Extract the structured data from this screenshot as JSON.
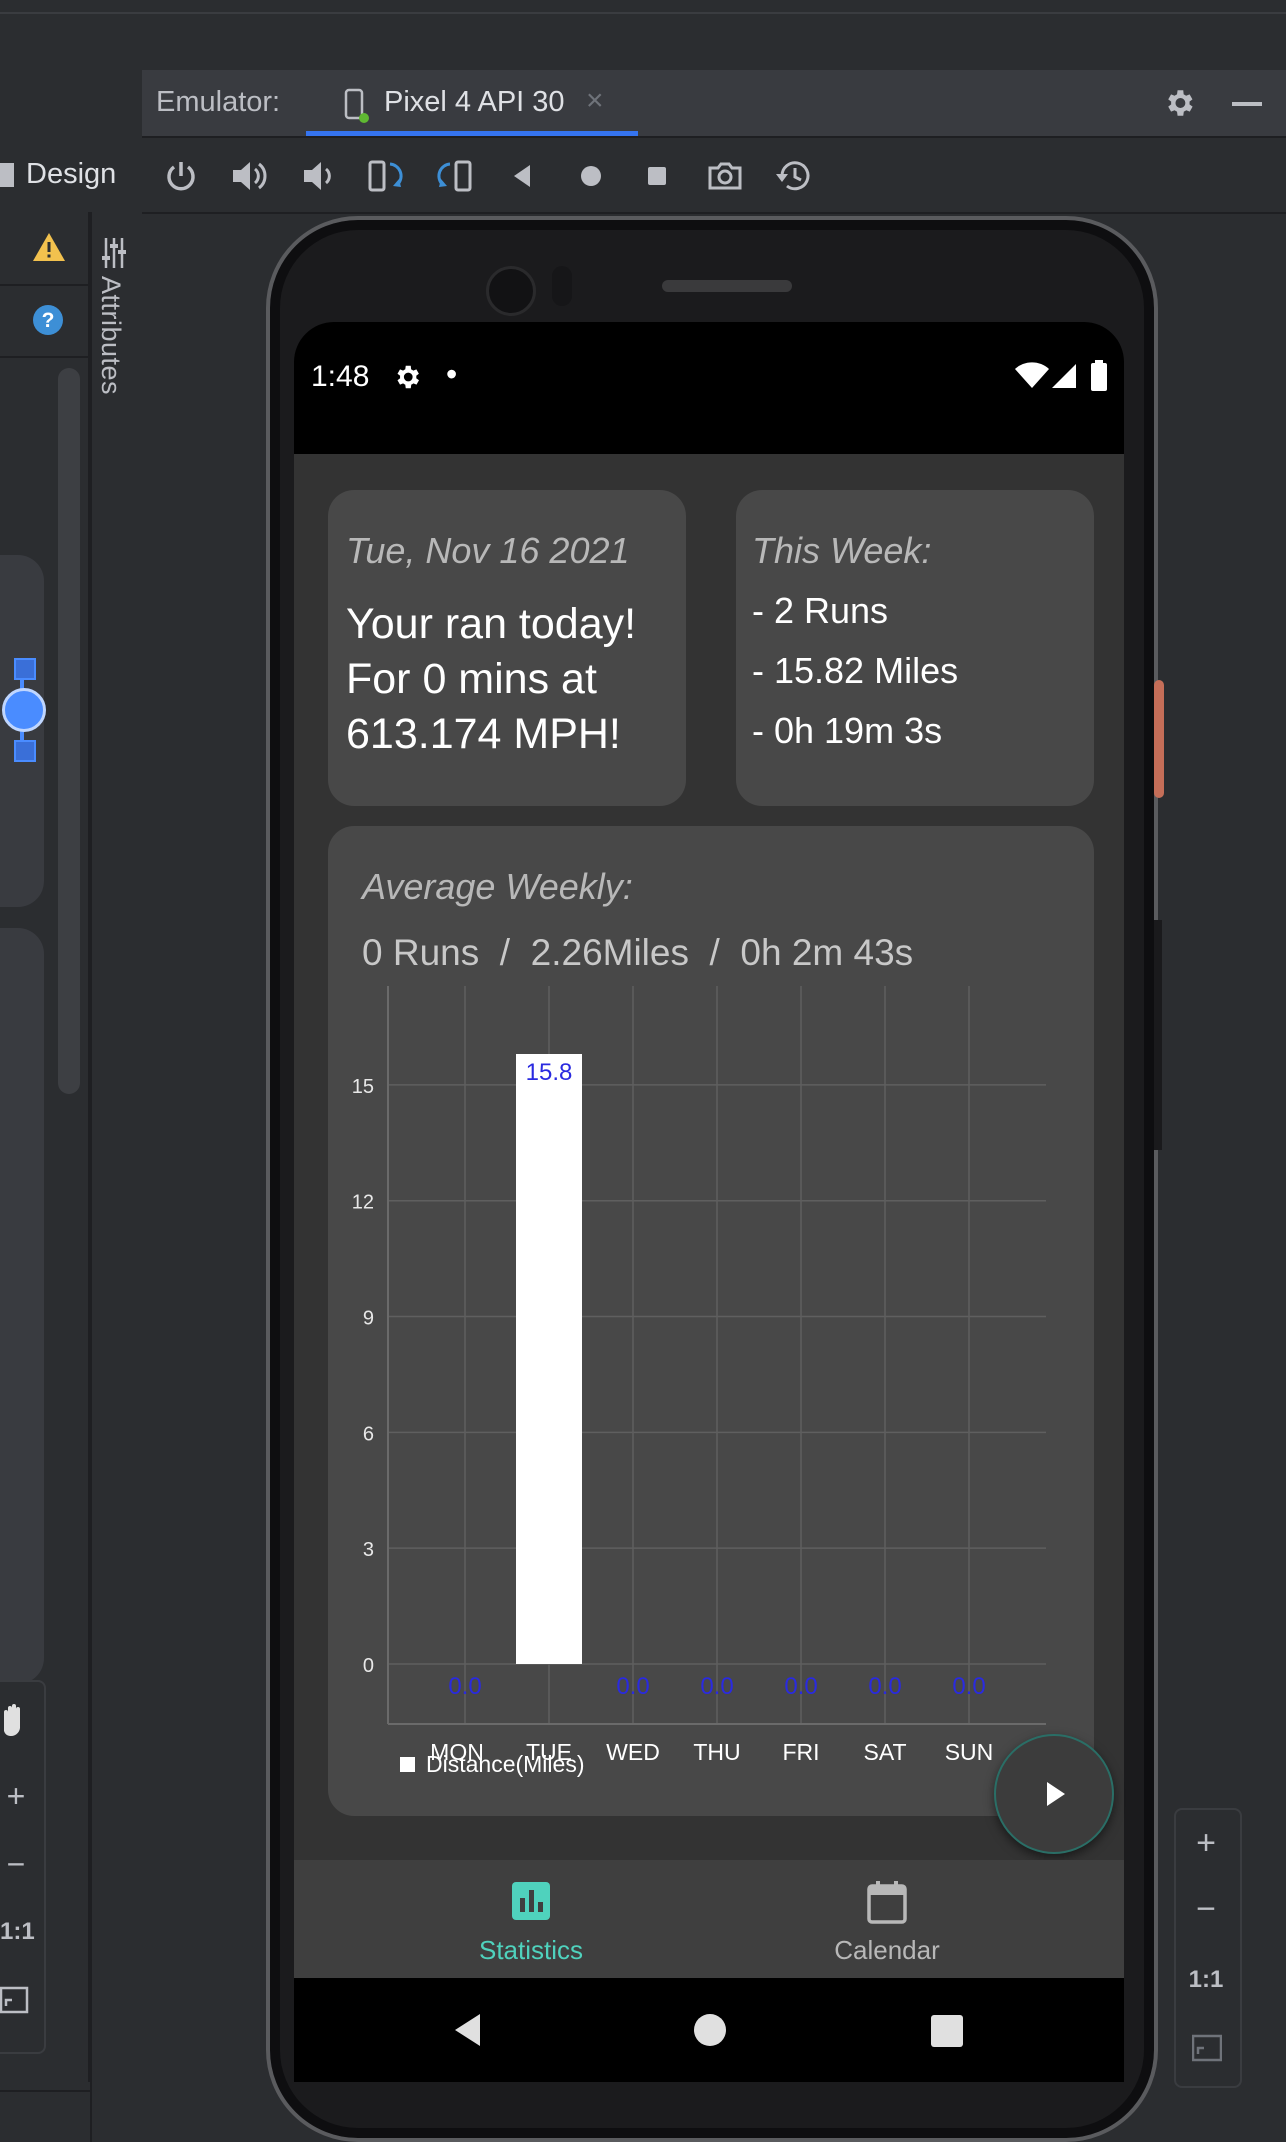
{
  "ide": {
    "emulator_label": "Emulator:",
    "device_name": "Pixel 4 API 30",
    "tab_close": "×",
    "design_label": "Design",
    "attributes_label": "Attributes",
    "left_zoom": {
      "plus": "+",
      "minus": "−",
      "one_to_one": "1:1"
    },
    "right_zoom": {
      "plus": "+",
      "minus": "−",
      "one_to_one": "1:1"
    },
    "toolbar_icons": [
      "power-icon",
      "volume-up-icon",
      "volume-down-icon",
      "rotate-left-icon",
      "rotate-right-icon",
      "back-icon",
      "home-icon",
      "overview-icon",
      "camera-icon",
      "snapshot-icon"
    ],
    "accent_color": "#3574f0"
  },
  "phone": {
    "status": {
      "time": "1:48",
      "dot": "•"
    },
    "today_card": {
      "date": "Tue, Nov 16 2021",
      "line1": "Your ran today!",
      "line2": "For 0 mins at",
      "line3": "613.174 MPH!"
    },
    "week_card": {
      "title": "This Week:",
      "runs": "- 2 Runs",
      "miles": "- 15.82 Miles",
      "time": "- 0h 19m 3s"
    },
    "average_card": {
      "title": "Average Weekly:",
      "summary": "0 Runs  /  2.26Miles  /  0h 2m 43s"
    },
    "bottom_nav": [
      {
        "label": "Statistics",
        "icon": "bar-chart-icon",
        "active": true
      },
      {
        "label": "Calendar",
        "icon": "calendar-icon",
        "active": false
      }
    ],
    "accent_color": "#4fd2bd"
  },
  "chart_data": {
    "type": "bar",
    "categories": [
      "MON",
      "TUE",
      "WED",
      "THU",
      "FRI",
      "SAT",
      "SUN"
    ],
    "series": [
      {
        "name": "Distance(Miles)",
        "values": [
          0.0,
          15.8,
          0.0,
          0.0,
          0.0,
          0.0,
          0.0
        ],
        "color": "#ffffff"
      }
    ],
    "value_labels": [
      "0.0",
      "15.8",
      "0.0",
      "0.0",
      "0.0",
      "0.0",
      "0.0"
    ],
    "yticks": [
      "0",
      "3",
      "6",
      "9",
      "12",
      "15"
    ],
    "ylim": [
      0,
      15.8
    ],
    "grid": true,
    "legend_placement": "bottom-left",
    "title": "",
    "xlabel": "",
    "ylabel": ""
  }
}
